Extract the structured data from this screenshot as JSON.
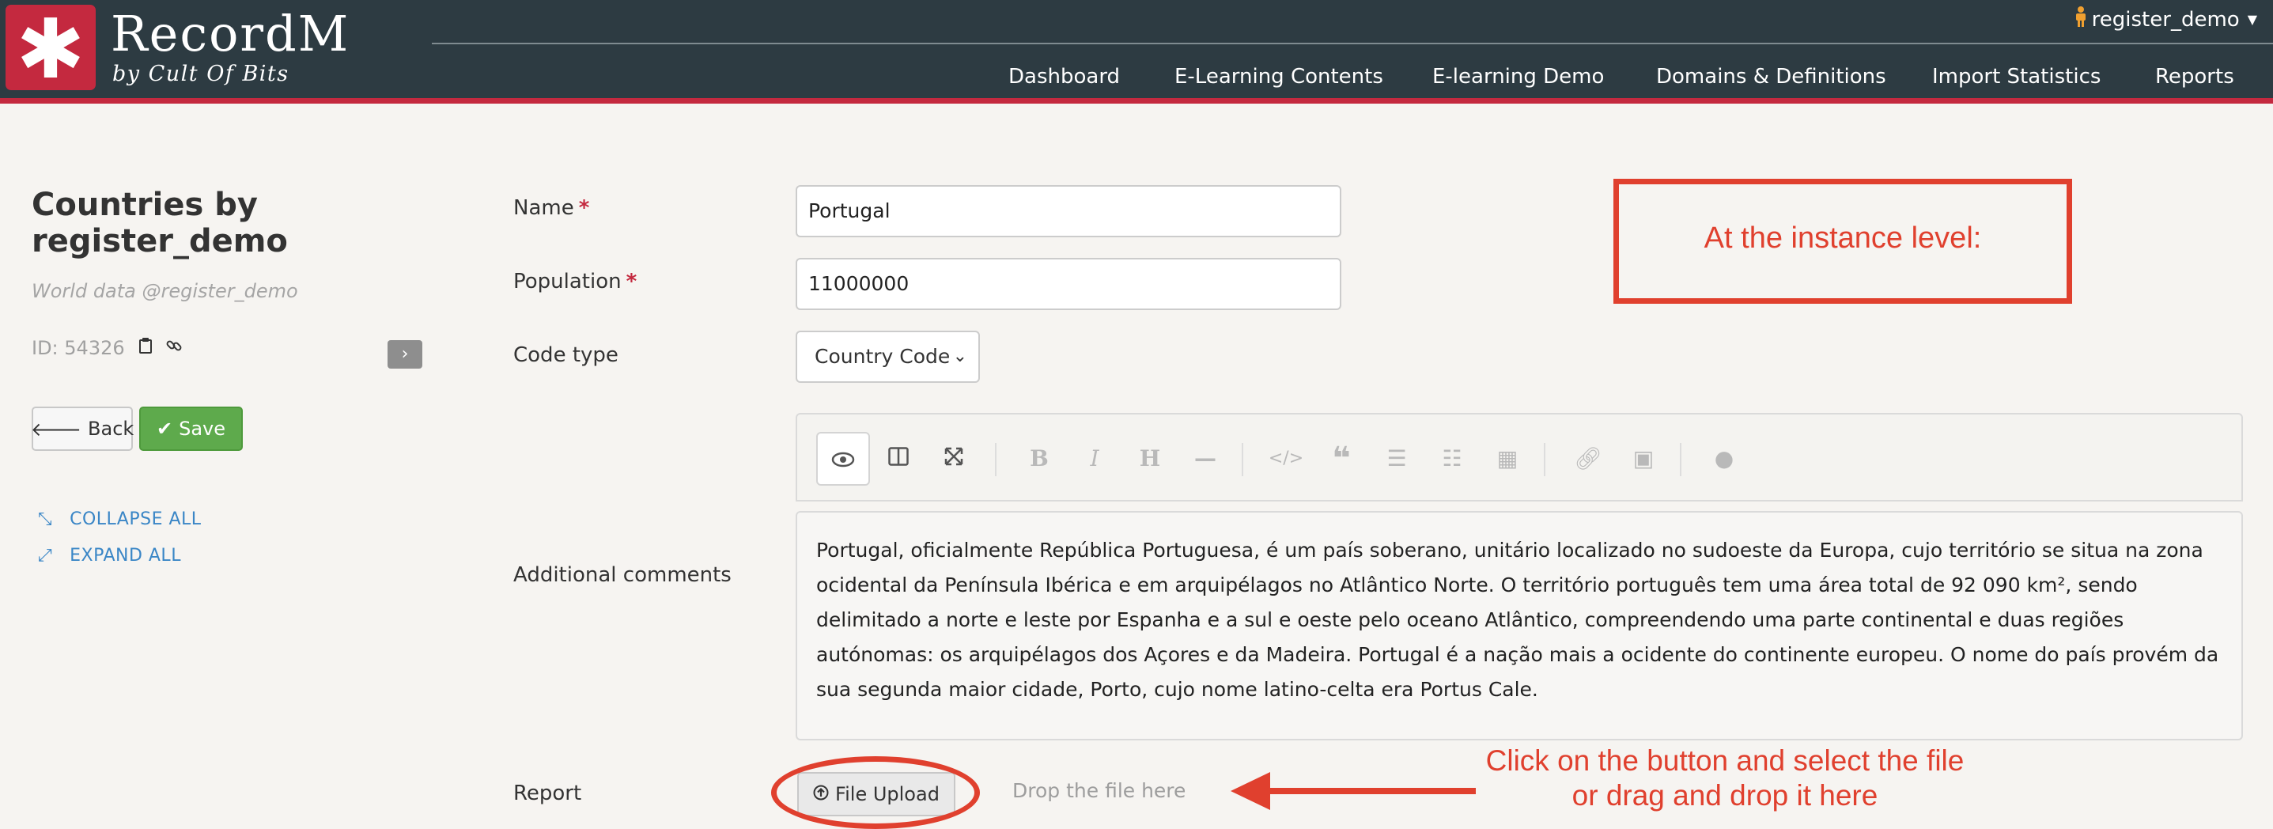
{
  "header": {
    "logo_glyph": "✱",
    "brand": "RecordM",
    "brand_sub": "by Cult Of Bits",
    "user": "register_demo",
    "nav": [
      "Dashboard",
      "E-Learning Contents",
      "E-learning Demo",
      "Domains & Definitions",
      "Import Statistics",
      "Reports"
    ]
  },
  "sidebar": {
    "title_line1": "Countries by",
    "title_line2": "register_demo",
    "subtitle": "World data @register_demo",
    "id_label": "ID: 54326",
    "back_label": "Back",
    "save_label": "Save",
    "collapse_all": "COLLAPSE ALL",
    "expand_all": "EXPAND ALL"
  },
  "form": {
    "name": {
      "label": "Name",
      "required": "*",
      "value": "Portugal"
    },
    "population": {
      "label": "Population",
      "required": "*",
      "value": "11000000"
    },
    "code_type": {
      "label": "Code type",
      "value": "Country Code"
    },
    "comments": {
      "label": "Additional comments",
      "toolbar_icons": [
        "preview-icon",
        "side-by-side-icon",
        "fullscreen-icon",
        "bold-icon",
        "italic-icon",
        "heading-icon",
        "horizontal-rule-icon",
        "code-icon",
        "quote-icon",
        "unordered-list-icon",
        "ordered-list-icon",
        "table-icon",
        "link-icon",
        "image-icon",
        "help-icon"
      ],
      "value": "Portugal, oficialmente República Portuguesa, é um país soberano, unitário localizado no sudoeste da Europa, cujo território se situa na zona ocidental da Península Ibérica e em arquipélagos no Atlântico Norte. O território português tem uma área total de 92 090 km², sendo delimitado a norte e leste por Espanha e a sul e oeste pelo oceano Atlântico, compreendendo uma parte continental e duas regiões autónomas: os arquipélagos dos Açores e da Madeira. Portugal é a nação mais a ocidente do continente europeu. O nome do país provém da sua segunda maior cidade, Porto, cujo nome latino-celta era Portus Cale."
    },
    "report": {
      "label": "Report",
      "upload_label": "File Upload",
      "drop_text": "Drop the file here"
    }
  },
  "annotations": {
    "instance_level": "At the instance level:",
    "upload_hint_line1": "Click on the button and select the file",
    "upload_hint_line2": "or drag and drop it here",
    "color": "#e0402e"
  },
  "colors": {
    "header_bg": "#2d3b42",
    "brand_red": "#c4293f",
    "save_green": "#5eaa4c",
    "link_blue": "#3a86c6"
  }
}
